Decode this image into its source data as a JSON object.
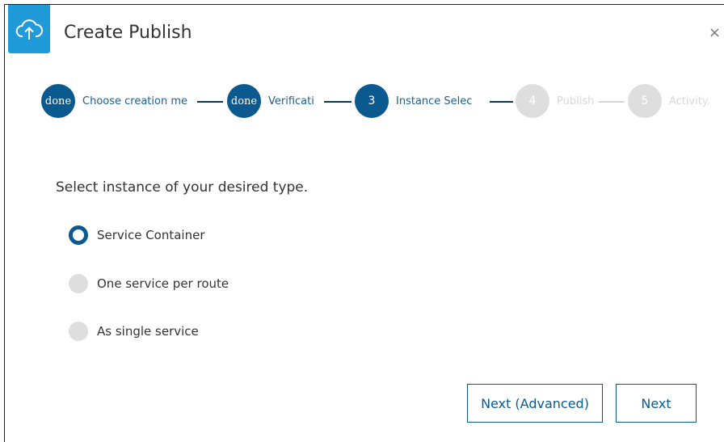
{
  "dialog": {
    "title": "Create Publish",
    "close_symbol": "×",
    "header_icon": "cloud-upload-icon",
    "accent_color": "#1f9bd9",
    "primary_color": "#0b5a8f"
  },
  "stepper": {
    "steps": [
      {
        "badge": "done",
        "label": "Choose creation me",
        "state": "done"
      },
      {
        "badge": "done",
        "label": "Verificati",
        "state": "done"
      },
      {
        "badge": "3",
        "label": "Instance Selec",
        "state": "active"
      },
      {
        "badge": "4",
        "label": "Publish",
        "state": "todo"
      },
      {
        "badge": "5",
        "label": "Activity.",
        "state": "todo"
      }
    ]
  },
  "content": {
    "prompt": "Select instance of your desired type.",
    "options": [
      {
        "label": "Service Container",
        "selected": true
      },
      {
        "label": "One service per route",
        "selected": false
      },
      {
        "label": "As single service",
        "selected": false
      }
    ]
  },
  "footer": {
    "next_advanced_label": "Next (Advanced)",
    "next_label": "Next"
  }
}
